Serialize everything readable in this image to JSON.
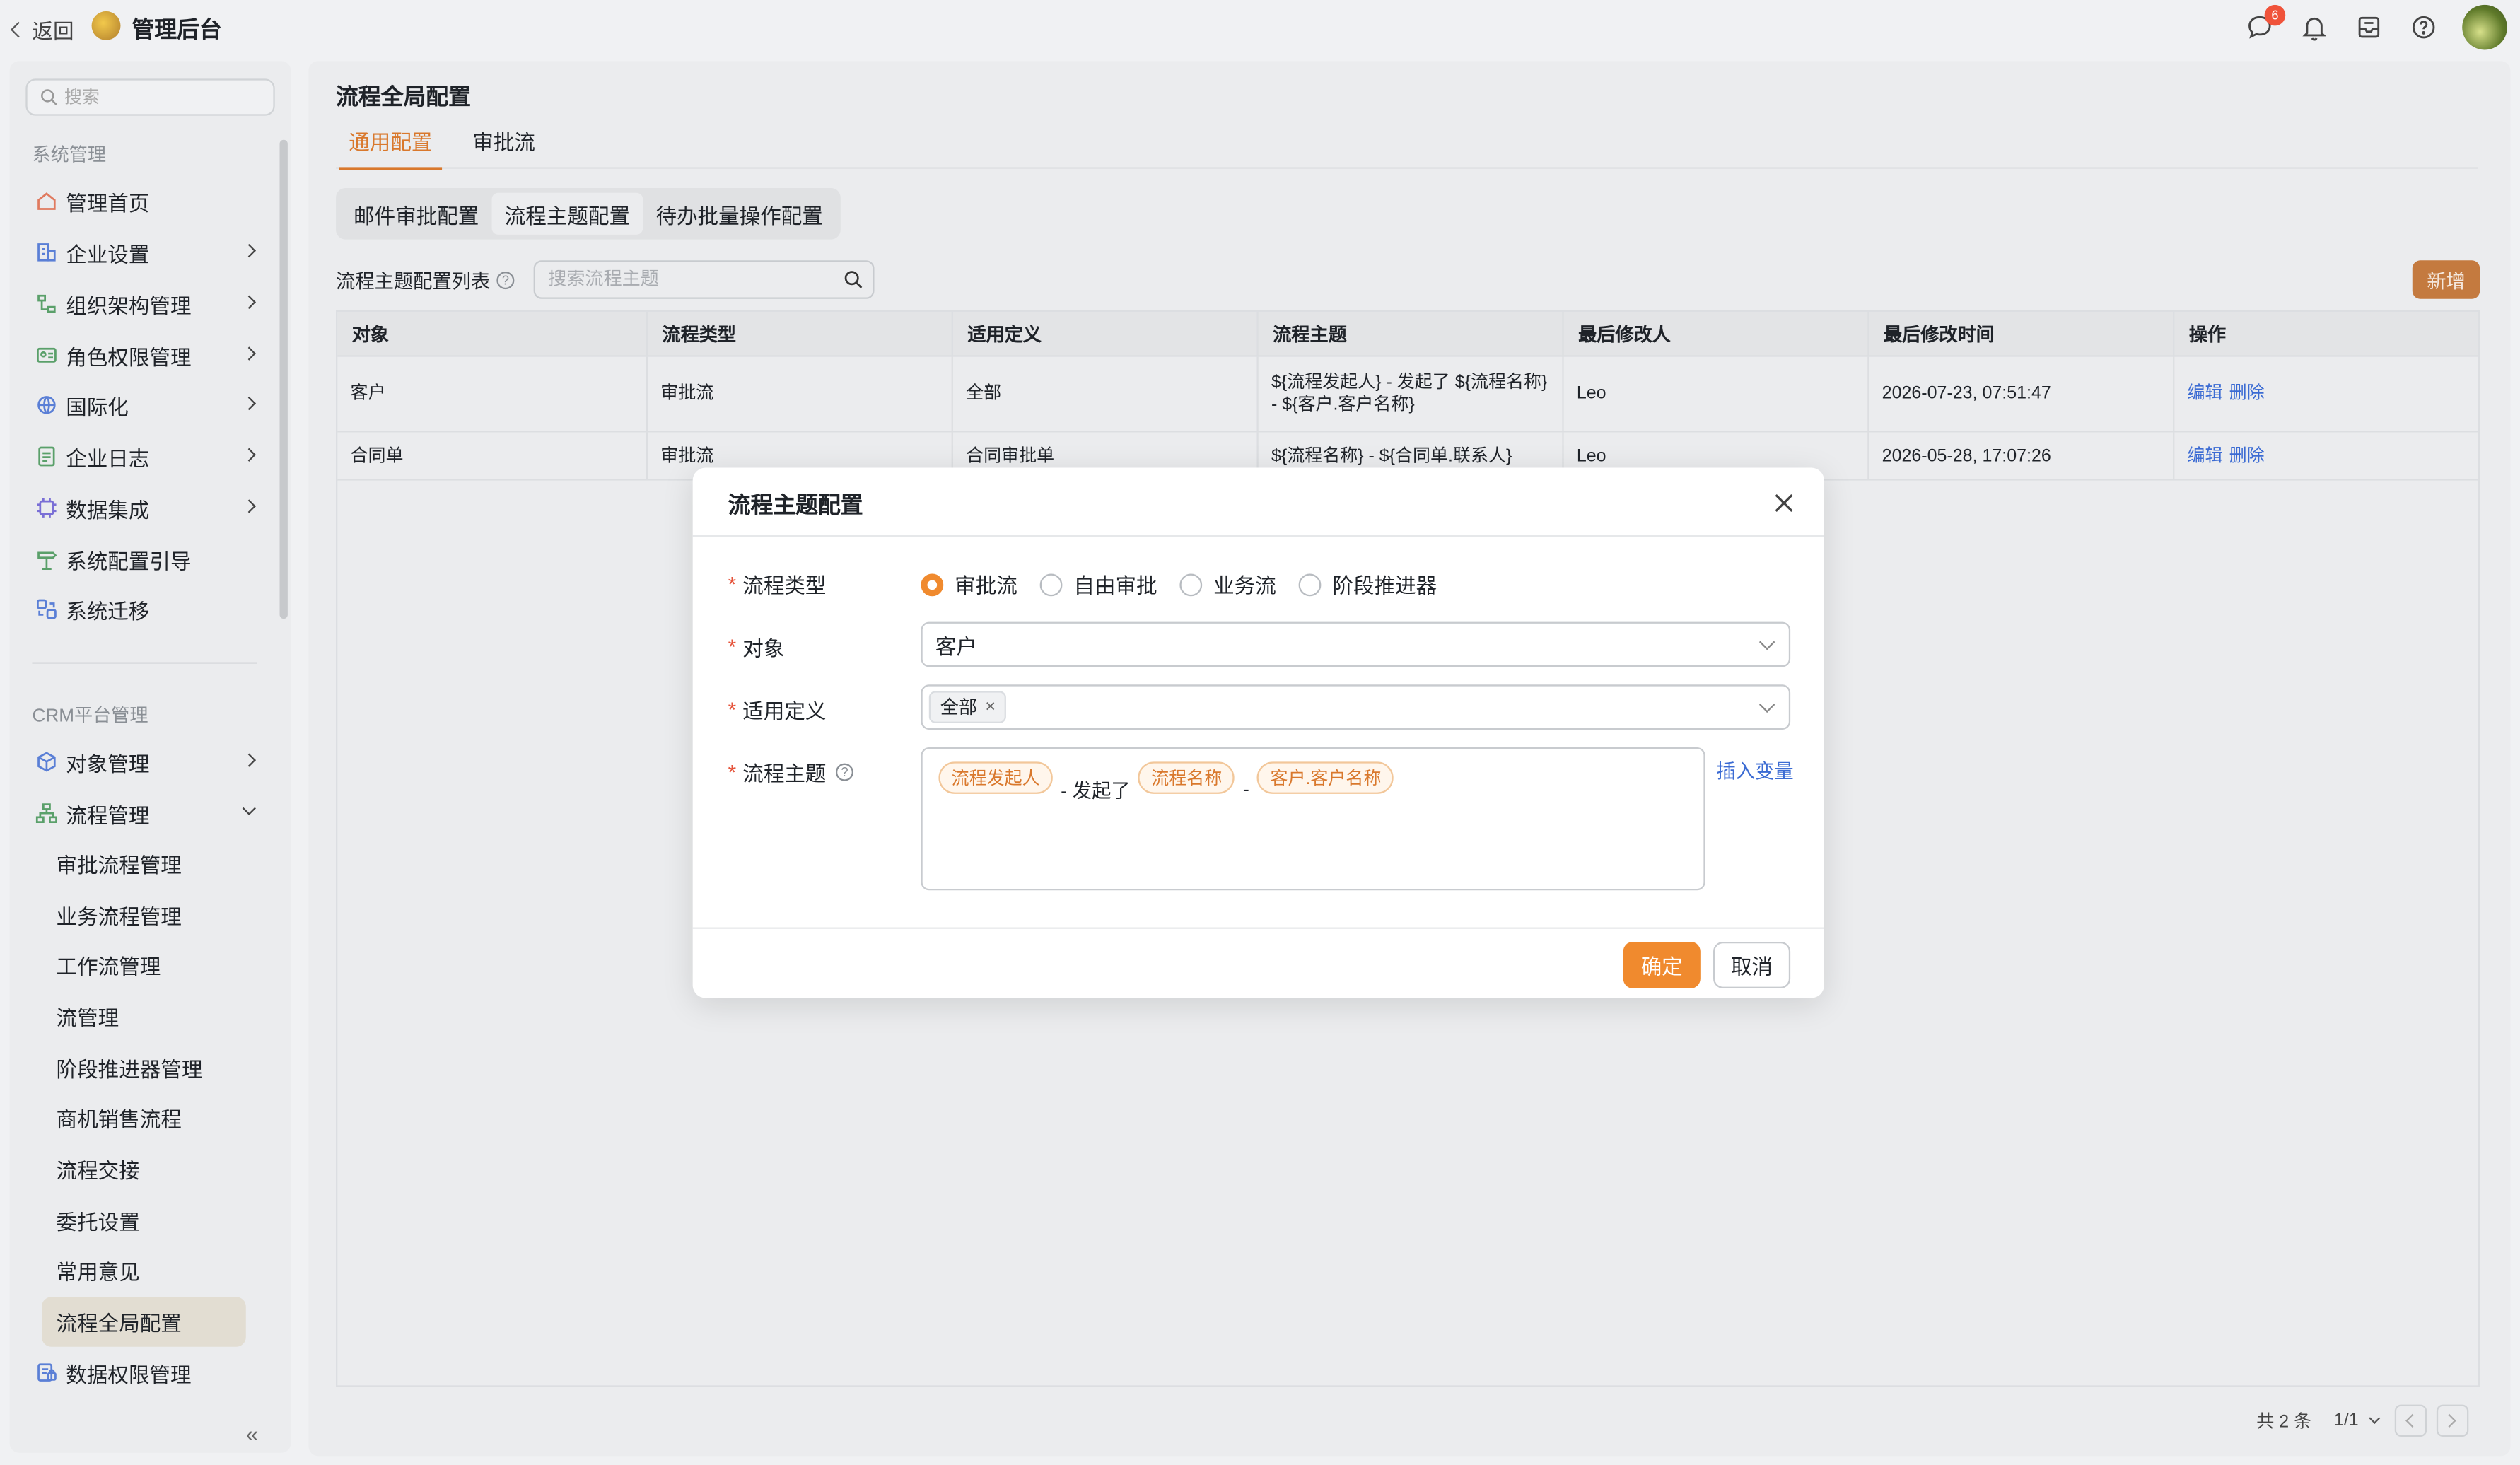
{
  "topbar": {
    "back_label": "返回",
    "app_title": "管理后台",
    "message_badge": "6"
  },
  "sidebar": {
    "search_placeholder": "搜索",
    "section_system": "系统管理",
    "system_items": [
      {
        "label": "管理首页",
        "icon": "home-icon"
      },
      {
        "label": "企业设置",
        "icon": "building-icon"
      },
      {
        "label": "组织架构管理",
        "icon": "org-icon"
      },
      {
        "label": "角色权限管理",
        "icon": "id-card-icon"
      },
      {
        "label": "国际化",
        "icon": "globe-icon"
      },
      {
        "label": "企业日志",
        "icon": "log-icon"
      },
      {
        "label": "数据集成",
        "icon": "chip-icon"
      },
      {
        "label": "系统配置引导",
        "icon": "signpost-icon"
      },
      {
        "label": "系统迁移",
        "icon": "migrate-icon"
      }
    ],
    "section_crm": "CRM平台管理",
    "crm_items": [
      {
        "label": "对象管理",
        "icon": "cube-icon"
      },
      {
        "label": "流程管理",
        "icon": "flow-icon"
      }
    ],
    "flow_sub_items": [
      "审批流程管理",
      "业务流程管理",
      "工作流管理",
      "流管理",
      "阶段推进器管理",
      "商机销售流程",
      "流程交接",
      "委托设置",
      "常用意见",
      "流程全局配置"
    ],
    "last_item": {
      "label": "数据权限管理",
      "icon": "data-lock-icon"
    }
  },
  "main": {
    "title": "流程全局配置",
    "tabs": [
      "通用配置",
      "审批流"
    ],
    "segments": [
      "邮件审批配置",
      "流程主题配置",
      "待办批量操作配置"
    ],
    "list_label": "流程主题配置列表",
    "search_placeholder": "搜索流程主题",
    "new_button": "新增",
    "columns": [
      "对象",
      "流程类型",
      "适用定义",
      "流程主题",
      "最后修改人",
      "最后修改时间",
      "操作"
    ],
    "rows": [
      {
        "object": "客户",
        "type": "审批流",
        "definition": "全部",
        "subject": "${流程发起人} - 发起了 ${流程名称} - ${客户.客户名称}",
        "modifier": "Leo",
        "time": "2026-07-23, 07:51:47",
        "edit": "编辑",
        "delete": "删除"
      },
      {
        "object": "合同单",
        "type": "审批流",
        "definition": "合同审批单",
        "subject": "${流程名称} - ${合同单.联系人}",
        "modifier": "Leo",
        "time": "2026-05-28, 17:07:26",
        "edit": "编辑",
        "delete": "删除"
      }
    ],
    "pager": {
      "total": "共 2 条",
      "page": "1/1"
    }
  },
  "modal": {
    "title": "流程主题配置",
    "type_label": "流程类型",
    "type_options": [
      "审批流",
      "自由审批",
      "业务流",
      "阶段推进器"
    ],
    "type_selected": "审批流",
    "object_label": "对象",
    "object_value": "客户",
    "definition_label": "适用定义",
    "definition_tag": "全部",
    "subject_label": "流程主题",
    "subject_tokens": [
      {
        "kind": "var",
        "text": "流程发起人"
      },
      {
        "kind": "text",
        "text": "- 发起了"
      },
      {
        "kind": "var",
        "text": "流程名称"
      },
      {
        "kind": "text",
        "text": "-"
      },
      {
        "kind": "var",
        "text": "客户.客户名称"
      }
    ],
    "insert_variable": "插入变量",
    "ok": "确定",
    "cancel": "取消"
  },
  "colors": {
    "accent": "#f08a2e",
    "link": "#3b6bd3",
    "required": "#e5533a"
  }
}
